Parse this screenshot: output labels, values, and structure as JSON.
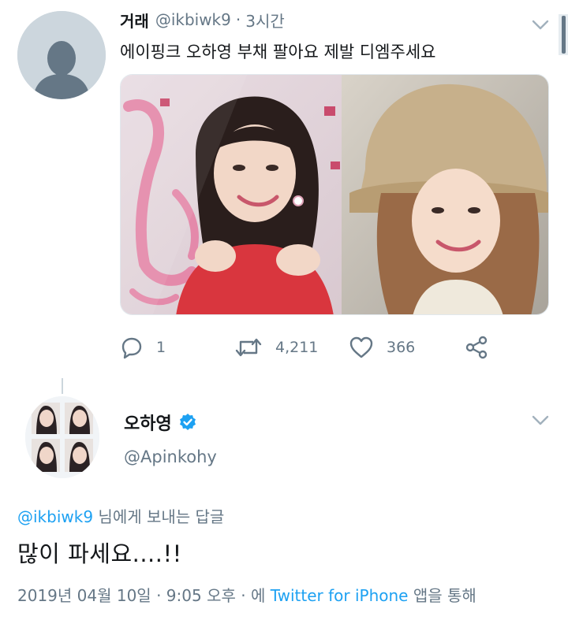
{
  "tweet1": {
    "name": "거래",
    "handle": "@ikbiwk9",
    "separator": "·",
    "time": "3시간",
    "text": "에이핑크 오하영 부채 팔아요 제발 디엠주세요",
    "media_alt": "photo-card",
    "reply_count": "1",
    "retweet_count": "4,211",
    "like_count": "366",
    "icons": {
      "reply": "reply-icon",
      "retweet": "retweet-icon",
      "like": "heart-icon",
      "share": "share-icon",
      "more": "chevron-down-icon"
    }
  },
  "tweet2": {
    "name": "오하영",
    "handle": "@Apinkohy",
    "verified": true,
    "replying_mention": "@ikbiwk9",
    "replying_suffix": "님에게 보내는 답글",
    "text": "많이 파세요....!!",
    "meta_date": "2019년 04월 10일",
    "meta_separator": "·",
    "meta_time": "9:05 오후",
    "meta_via_prefix": "· 에",
    "meta_source": "Twitter for iPhone",
    "meta_via_suffix": "앱을 통해"
  },
  "colors": {
    "accent": "#1da1f2",
    "secondary_text": "#657786",
    "primary_text": "#14171a"
  }
}
